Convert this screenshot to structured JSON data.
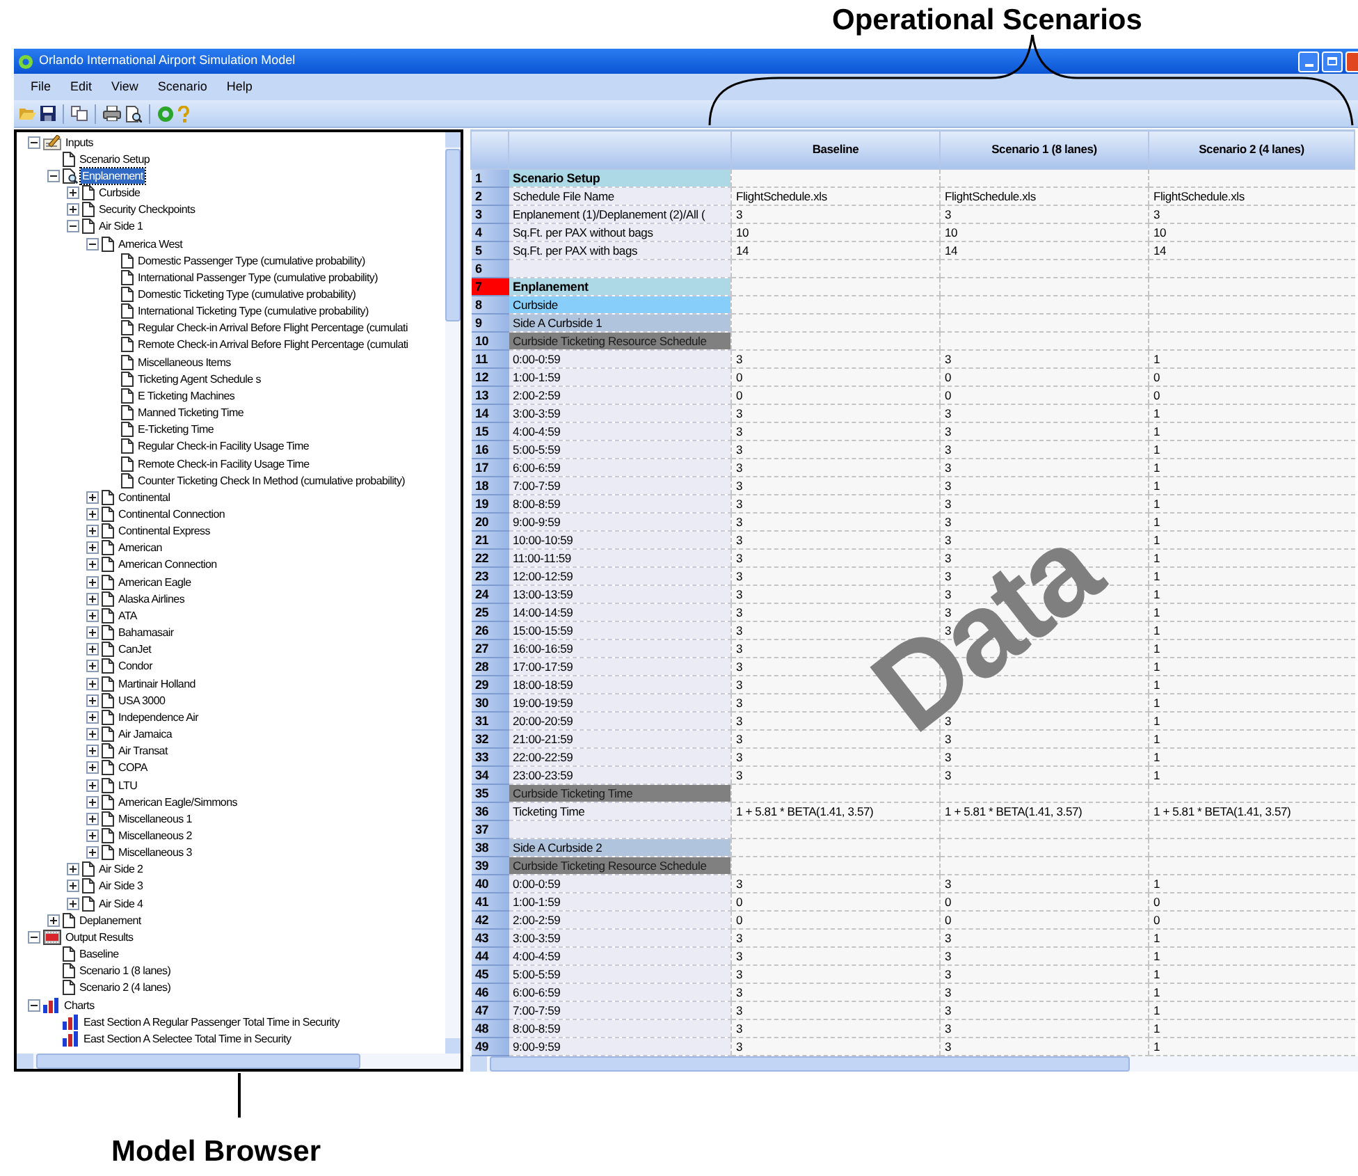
{
  "annotations": {
    "top_label": "Operational Scenarios",
    "overlay_label": "Data",
    "bottom_label": "Model Browser"
  },
  "window": {
    "title": "Orlando International Airport Simulation Model"
  },
  "menu": [
    "File",
    "Edit",
    "View",
    "Scenario",
    "Help"
  ],
  "tree": [
    {
      "label": "Inputs",
      "kind": "inputs",
      "expanded": true,
      "selected": false,
      "children": [
        {
          "label": "Scenario Setup",
          "kind": "page",
          "selected": false
        },
        {
          "label": "Enplanement",
          "kind": "search-page",
          "expanded": true,
          "selected": true,
          "children": [
            {
              "label": "Curbside",
              "kind": "page",
              "expanded": false,
              "selected": false
            },
            {
              "label": "Security Checkpoints",
              "kind": "page",
              "expanded": false,
              "selected": false
            },
            {
              "label": "Air Side 1",
              "kind": "page",
              "expanded": true,
              "selected": false,
              "children": [
                {
                  "label": "America West",
                  "kind": "page",
                  "expanded": true,
                  "selected": false,
                  "children": [
                    {
                      "label": "Domestic Passenger Type (cumulative probability)",
                      "kind": "page",
                      "selected": false
                    },
                    {
                      "label": "International Passenger Type (cumulative probability)",
                      "kind": "page",
                      "selected": false
                    },
                    {
                      "label": "Domestic Ticketing Type (cumulative probability)",
                      "kind": "page",
                      "selected": false
                    },
                    {
                      "label": "International Ticketing Type (cumulative probability)",
                      "kind": "page",
                      "selected": false
                    },
                    {
                      "label": "Regular Check-in Arrival Before Flight Percentage (cumulati",
                      "kind": "page",
                      "selected": false
                    },
                    {
                      "label": "Remote Check-in Arrival Before Flight Percentage (cumulati",
                      "kind": "page",
                      "selected": false
                    },
                    {
                      "label": "Miscellaneous Items",
                      "kind": "page",
                      "selected": false
                    },
                    {
                      "label": "Ticketing Agent Schedule s",
                      "kind": "page",
                      "selected": false
                    },
                    {
                      "label": "E Ticketing Machines",
                      "kind": "page",
                      "selected": false
                    },
                    {
                      "label": "Manned Ticketing Time",
                      "kind": "page",
                      "selected": false
                    },
                    {
                      "label": "E-Ticketing Time",
                      "kind": "page",
                      "selected": false
                    },
                    {
                      "label": "Regular Check-in Facility Usage Time",
                      "kind": "page",
                      "selected": false
                    },
                    {
                      "label": "Remote Check-in Facility Usage Time",
                      "kind": "page",
                      "selected": false
                    },
                    {
                      "label": "Counter Ticketing Check In Method (cumulative probability)",
                      "kind": "page",
                      "selected": false
                    }
                  ]
                },
                {
                  "label": "Continental",
                  "kind": "page",
                  "expanded": false,
                  "selected": false
                },
                {
                  "label": "Continental Connection",
                  "kind": "page",
                  "expanded": false,
                  "selected": false
                },
                {
                  "label": "Continental Express",
                  "kind": "page",
                  "expanded": false,
                  "selected": false
                },
                {
                  "label": "American",
                  "kind": "page",
                  "expanded": false,
                  "selected": false
                },
                {
                  "label": "American Connection",
                  "kind": "page",
                  "expanded": false,
                  "selected": false
                },
                {
                  "label": "American Eagle",
                  "kind": "page",
                  "expanded": false,
                  "selected": false
                },
                {
                  "label": "Alaska Airlines",
                  "kind": "page",
                  "expanded": false,
                  "selected": false
                },
                {
                  "label": "ATA",
                  "kind": "page",
                  "expanded": false,
                  "selected": false
                },
                {
                  "label": "Bahamasair",
                  "kind": "page",
                  "expanded": false,
                  "selected": false
                },
                {
                  "label": "CanJet",
                  "kind": "page",
                  "expanded": false,
                  "selected": false
                },
                {
                  "label": "Condor",
                  "kind": "page",
                  "expanded": false,
                  "selected": false
                },
                {
                  "label": "Martinair Holland",
                  "kind": "page",
                  "expanded": false,
                  "selected": false
                },
                {
                  "label": "USA 3000",
                  "kind": "page",
                  "expanded": false,
                  "selected": false
                },
                {
                  "label": "Independence Air",
                  "kind": "page",
                  "expanded": false,
                  "selected": false
                },
                {
                  "label": "Air Jamaica",
                  "kind": "page",
                  "expanded": false,
                  "selected": false
                },
                {
                  "label": "Air Transat",
                  "kind": "page",
                  "expanded": false,
                  "selected": false
                },
                {
                  "label": "COPA",
                  "kind": "page",
                  "expanded": false,
                  "selected": false
                },
                {
                  "label": "LTU",
                  "kind": "page",
                  "expanded": false,
                  "selected": false
                },
                {
                  "label": "American Eagle/Simmons",
                  "kind": "page",
                  "expanded": false,
                  "selected": false
                },
                {
                  "label": "Miscellaneous 1",
                  "kind": "page",
                  "expanded": false,
                  "selected": false
                },
                {
                  "label": "Miscellaneous 2",
                  "kind": "page",
                  "expanded": false,
                  "selected": false
                },
                {
                  "label": "Miscellaneous 3",
                  "kind": "page",
                  "expanded": false,
                  "selected": false
                }
              ]
            },
            {
              "label": "Air Side 2",
              "kind": "page",
              "expanded": false,
              "selected": false
            },
            {
              "label": "Air Side 3",
              "kind": "page",
              "expanded": false,
              "selected": false
            },
            {
              "label": "Air Side 4",
              "kind": "page",
              "expanded": false,
              "selected": false
            }
          ]
        },
        {
          "label": "Deplanement",
          "kind": "page",
          "expanded": false,
          "selected": false
        }
      ]
    },
    {
      "label": "Output Results",
      "kind": "results",
      "expanded": true,
      "selected": false,
      "children": [
        {
          "label": "Baseline",
          "kind": "page",
          "selected": false
        },
        {
          "label": "Scenario 1 (8 lanes)",
          "kind": "page",
          "selected": false
        },
        {
          "label": "Scenario 2 (4 lanes)",
          "kind": "page",
          "selected": false
        }
      ]
    },
    {
      "label": "Charts",
      "kind": "chart",
      "expanded": true,
      "selected": false,
      "children": [
        {
          "label": "East Section A Regular Passenger Total Time in Security",
          "kind": "chart",
          "selected": false
        },
        {
          "label": "East Section A Selectee Total Time in Security",
          "kind": "chart",
          "selected": false
        }
      ]
    }
  ],
  "table": {
    "columns": [
      "Baseline",
      "Scenario 1 (8 lanes)",
      "Scenario 2 (4 lanes)"
    ],
    "rows": [
      {
        "number": "1",
        "label": "Scenario Setup",
        "kind": "section"
      },
      {
        "number": "2",
        "label": "Schedule File Name",
        "kind": "data",
        "values": [
          "FlightSchedule.xls",
          "FlightSchedule.xls",
          "FlightSchedule.xls"
        ]
      },
      {
        "number": "3",
        "label": "Enplanement (1)/Deplanement (2)/All (",
        "kind": "data",
        "values": [
          "3",
          "3",
          "3"
        ]
      },
      {
        "number": "4",
        "label": "Sq.Ft. per PAX without bags",
        "kind": "data",
        "values": [
          "10",
          "10",
          "10"
        ]
      },
      {
        "number": "5",
        "label": "Sq.Ft. per PAX with bags",
        "kind": "data",
        "values": [
          "14",
          "14",
          "14"
        ]
      },
      {
        "number": "6",
        "kind": "data"
      },
      {
        "number": "7",
        "label": "Enplanement",
        "kind": "section",
        "flagged": true
      },
      {
        "number": "8",
        "label": "Curbside",
        "kind": "group"
      },
      {
        "number": "9",
        "label": "Side A Curbside 1",
        "kind": "subgroup"
      },
      {
        "number": "10",
        "label": "Curbside Ticketing Resource Schedule",
        "kind": "schedule"
      },
      {
        "number": "11",
        "label": "0:00-0:59",
        "kind": "data",
        "values": [
          "3",
          "3",
          "1"
        ]
      },
      {
        "number": "12",
        "label": "1:00-1:59",
        "kind": "data",
        "values": [
          "0",
          "0",
          "0"
        ]
      },
      {
        "number": "13",
        "label": "2:00-2:59",
        "kind": "data",
        "values": [
          "0",
          "0",
          "0"
        ]
      },
      {
        "number": "14",
        "label": "3:00-3:59",
        "kind": "data",
        "values": [
          "3",
          "3",
          "1"
        ]
      },
      {
        "number": "15",
        "label": "4:00-4:59",
        "kind": "data",
        "values": [
          "3",
          "3",
          "1"
        ]
      },
      {
        "number": "16",
        "label": "5:00-5:59",
        "kind": "data",
        "values": [
          "3",
          "3",
          "1"
        ]
      },
      {
        "number": "17",
        "label": "6:00-6:59",
        "kind": "data",
        "values": [
          "3",
          "3",
          "1"
        ]
      },
      {
        "number": "18",
        "label": "7:00-7:59",
        "kind": "data",
        "values": [
          "3",
          "3",
          "1"
        ]
      },
      {
        "number": "19",
        "label": "8:00-8:59",
        "kind": "data",
        "values": [
          "3",
          "3",
          "1"
        ]
      },
      {
        "number": "20",
        "label": "9:00-9:59",
        "kind": "data",
        "values": [
          "3",
          "3",
          "1"
        ]
      },
      {
        "number": "21",
        "label": "10:00-10:59",
        "kind": "data",
        "values": [
          "3",
          "3",
          "1"
        ]
      },
      {
        "number": "22",
        "label": "11:00-11:59",
        "kind": "data",
        "values": [
          "3",
          "3",
          "1"
        ]
      },
      {
        "number": "23",
        "label": "12:00-12:59",
        "kind": "data",
        "values": [
          "3",
          "3",
          "1"
        ]
      },
      {
        "number": "24",
        "label": "13:00-13:59",
        "kind": "data",
        "values": [
          "3",
          "3",
          "1"
        ]
      },
      {
        "number": "25",
        "label": "14:00-14:59",
        "kind": "data",
        "values": [
          "3",
          "3",
          "1"
        ]
      },
      {
        "number": "26",
        "label": "15:00-15:59",
        "kind": "data",
        "values": [
          "3",
          "3",
          "1"
        ]
      },
      {
        "number": "27",
        "label": "16:00-16:59",
        "kind": "data",
        "baseline": "3",
        "scenario_2": "1"
      },
      {
        "number": "28",
        "label": "17:00-17:59",
        "kind": "data",
        "baseline": "3",
        "scenario_2": "1"
      },
      {
        "number": "29",
        "label": "18:00-18:59",
        "kind": "data",
        "baseline": "3",
        "scenario_2": "1"
      },
      {
        "number": "30",
        "label": "19:00-19:59",
        "kind": "data",
        "baseline": "3",
        "scenario_2": "1"
      },
      {
        "number": "31",
        "label": "20:00-20:59",
        "kind": "data",
        "values": [
          "3",
          "3",
          "1"
        ]
      },
      {
        "number": "32",
        "label": "21:00-21:59",
        "kind": "data",
        "values": [
          "3",
          "3",
          "1"
        ]
      },
      {
        "number": "33",
        "label": "22:00-22:59",
        "kind": "data",
        "values": [
          "3",
          "3",
          "1"
        ]
      },
      {
        "number": "34",
        "label": "23:00-23:59",
        "kind": "data",
        "values": [
          "3",
          "3",
          "1"
        ]
      },
      {
        "number": "35",
        "label": "Curbside Ticketing Time",
        "kind": "schedule"
      },
      {
        "number": "36",
        "label": "Ticketing Time",
        "kind": "data",
        "values": [
          "1 + 5.81 * BETA(1.41, 3.57)",
          "1 + 5.81 * BETA(1.41, 3.57)",
          "1 + 5.81 * BETA(1.41, 3.57)"
        ]
      },
      {
        "number": "37",
        "kind": "data"
      },
      {
        "number": "38",
        "label": "Side A Curbside 2",
        "kind": "subgroup"
      },
      {
        "number": "39",
        "label": "Curbside Ticketing Resource Schedule",
        "kind": "schedule"
      },
      {
        "number": "40",
        "label": "0:00-0:59",
        "kind": "data",
        "values": [
          "3",
          "3",
          "1"
        ]
      },
      {
        "number": "41",
        "label": "1:00-1:59",
        "kind": "data",
        "values": [
          "0",
          "0",
          "0"
        ]
      },
      {
        "number": "42",
        "label": "2:00-2:59",
        "kind": "data",
        "values": [
          "0",
          "0",
          "0"
        ]
      },
      {
        "number": "43",
        "label": "3:00-3:59",
        "kind": "data",
        "values": [
          "3",
          "3",
          "1"
        ]
      },
      {
        "number": "44",
        "label": "4:00-4:59",
        "kind": "data",
        "values": [
          "3",
          "3",
          "1"
        ]
      },
      {
        "number": "45",
        "label": "5:00-5:59",
        "kind": "data",
        "values": [
          "3",
          "3",
          "1"
        ]
      },
      {
        "number": "46",
        "label": "6:00-6:59",
        "kind": "data",
        "values": [
          "3",
          "3",
          "1"
        ]
      },
      {
        "number": "47",
        "label": "7:00-7:59",
        "kind": "data",
        "values": [
          "3",
          "3",
          "1"
        ]
      },
      {
        "number": "48",
        "label": "8:00-8:59",
        "kind": "data",
        "values": [
          "3",
          "3",
          "1"
        ]
      },
      {
        "number": "49",
        "label": "9:00-9:59",
        "kind": "data",
        "values": [
          "3",
          "3",
          "1"
        ]
      }
    ]
  }
}
